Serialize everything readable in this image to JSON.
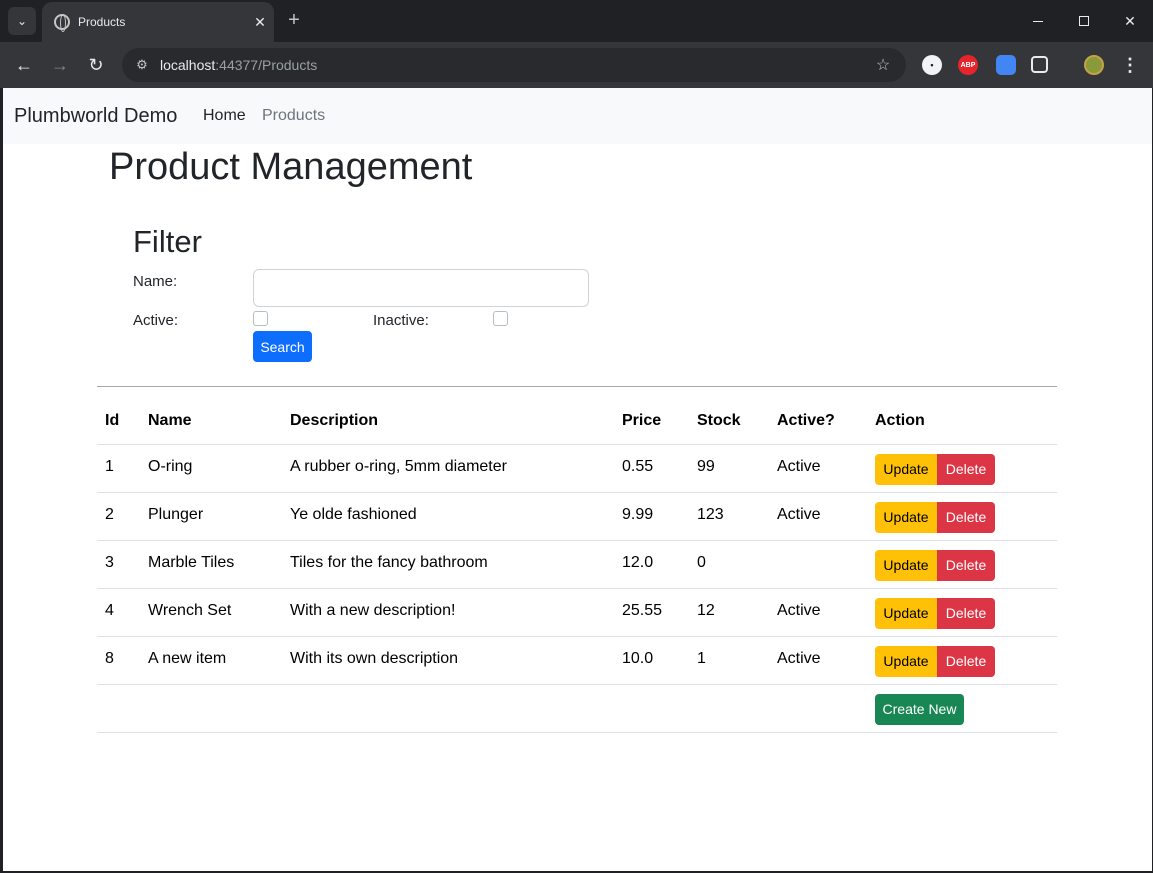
{
  "browser": {
    "tab_title": "Products",
    "tab_close": "✕",
    "new_tab": "+",
    "url_host": "localhost",
    "url_path": ":44377/Products",
    "extensions": {
      "abp_label": "ABP"
    },
    "icons": [
      "tab-search-icon",
      "globe-icon",
      "back-icon",
      "forward-icon",
      "reload-icon",
      "site-info-icon",
      "star-icon",
      "extension-icon",
      "adblock-icon",
      "puzzle-icon",
      "profile-icon",
      "menu-icon"
    ]
  },
  "navbar": {
    "brand": "Plumbworld Demo",
    "links": [
      {
        "label": "Home"
      },
      {
        "label": "Products"
      }
    ]
  },
  "main": {
    "title": "Product Management",
    "filter": {
      "heading": "Filter",
      "name_label": "Name:",
      "name_value": "",
      "active_label": "Active:",
      "inactive_label": "Inactive:",
      "active_checked": false,
      "inactive_checked": false,
      "search_label": "Search"
    },
    "table": {
      "headers": [
        "Id",
        "Name",
        "Description",
        "Price",
        "Stock",
        "Active?",
        "Action"
      ],
      "rows": [
        {
          "id": "1",
          "name": "O-ring",
          "description": "A rubber o-ring, 5mm diameter",
          "price": "0.55",
          "stock": "99",
          "active": "Active"
        },
        {
          "id": "2",
          "name": "Plunger",
          "description": "Ye olde fashioned",
          "price": "9.99",
          "stock": "123",
          "active": "Active"
        },
        {
          "id": "3",
          "name": "Marble Tiles",
          "description": "Tiles for the fancy bathroom",
          "price": "12.0",
          "stock": "0",
          "active": ""
        },
        {
          "id": "4",
          "name": "Wrench Set",
          "description": "With a new description!",
          "price": "25.55",
          "stock": "12",
          "active": "Active"
        },
        {
          "id": "8",
          "name": "A new item",
          "description": "With its own description",
          "price": "10.0",
          "stock": "1",
          "active": "Active"
        }
      ],
      "update_label": "Update",
      "delete_label": "Delete",
      "create_label": "Create New"
    }
  },
  "colors": {
    "primary": "#0d6efd",
    "warning": "#ffc107",
    "danger": "#dc3545",
    "success": "#198754"
  }
}
